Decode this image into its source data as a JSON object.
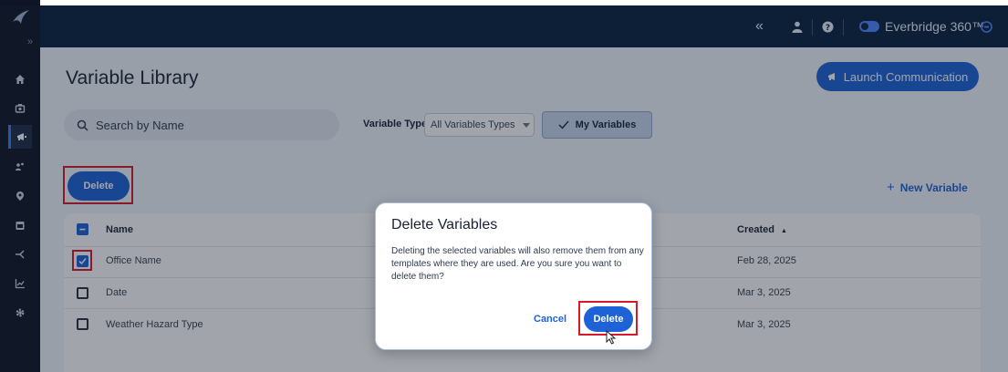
{
  "header": {
    "collapse_glyph": "«",
    "brand_label": "Everbridge 360™",
    "icons": [
      "user-icon",
      "help-icon",
      "toggle-icon",
      "brand-badge-icon"
    ]
  },
  "sidebar": {
    "expand_glyph": "»",
    "items": [
      {
        "icon": "home-icon"
      },
      {
        "icon": "incidents-icon"
      },
      {
        "icon": "communications-icon",
        "active": true
      },
      {
        "icon": "contacts-icon"
      },
      {
        "icon": "location-icon"
      },
      {
        "icon": "calendar-icon"
      },
      {
        "icon": "scenarios-icon"
      },
      {
        "icon": "analytics-icon"
      },
      {
        "icon": "settings-icon"
      }
    ]
  },
  "page": {
    "title": "Variable Library",
    "launch_label": "Launch Communication",
    "search_placeholder": "Search by Name",
    "variable_type_label": "Variable Type",
    "variable_type_value": "All Variables Types",
    "my_variables_label": "My Variables",
    "delete_label": "Delete",
    "new_variable_label": "New Variable"
  },
  "table": {
    "columns": {
      "name": "Name",
      "created": "Created"
    },
    "sort_indicator": "▲",
    "rows": [
      {
        "name": "Office Name",
        "created": "Feb 28, 2025",
        "checked": true
      },
      {
        "name": "Date",
        "created": "Mar 3, 2025",
        "checked": false
      },
      {
        "name": "Weather Hazard Type",
        "created": "Mar 3, 2025",
        "checked": false
      }
    ]
  },
  "modal": {
    "title": "Delete Variables",
    "body": "Deleting the selected variables will also remove them from any templates where they are used. Are you sure you want to delete them?",
    "cancel_label": "Cancel",
    "delete_label": "Delete"
  },
  "colors": {
    "accent": "#1d62d6",
    "header": "#07203f",
    "sidebar": "#0e1526",
    "highlight": "#d61a2a"
  }
}
